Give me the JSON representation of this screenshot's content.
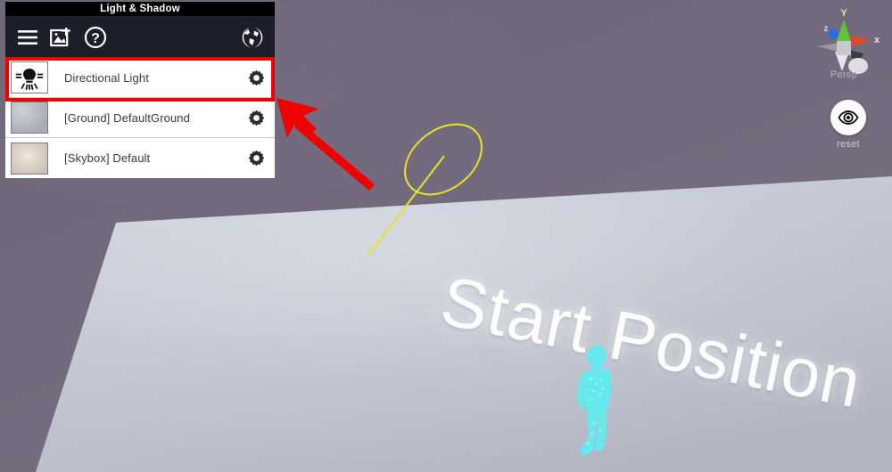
{
  "panel": {
    "title": "Light & Shadow",
    "toolbar": {
      "items": [
        {
          "name": "menu-icon",
          "label": "Menu"
        },
        {
          "name": "add-image-icon",
          "label": "Add Image"
        },
        {
          "name": "help-icon",
          "label": "Help"
        }
      ],
      "globe": {
        "name": "globe-icon",
        "label": "Environment"
      }
    },
    "rows": [
      {
        "label": "Directional Light",
        "thumb": "light-bulb-icon",
        "gear": "gear-icon",
        "selected": true
      },
      {
        "label": "[Ground] DefaultGround",
        "thumb": "ground-texture",
        "gear": "gear-icon",
        "selected": false
      },
      {
        "label": "[Skybox] Default",
        "thumb": "skybox-texture",
        "gear": "gear-icon",
        "selected": false
      }
    ]
  },
  "viewport": {
    "ground_label": "Start Position",
    "gizmo": {
      "mode_label": "Persp",
      "axis_x": "x",
      "axis_y": "Y",
      "axis_z": "z"
    },
    "reset": {
      "label": "reset",
      "icon": "eye-icon"
    }
  },
  "annotation": {
    "highlight_color": "#f00000",
    "arrow_color": "#f20000",
    "target": "Directional Light"
  },
  "colors": {
    "background": "#736a7d",
    "ground": "#c3c7d2",
    "light_gizmo": "#e8e425",
    "character": "#66e8ec",
    "panel_toolbar": "#1c1f2a",
    "title_bar": "#000000"
  }
}
